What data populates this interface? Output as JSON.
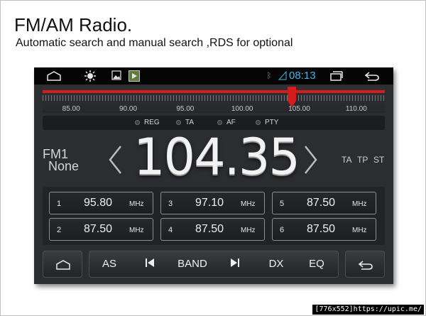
{
  "page": {
    "headline": "FM/AM Radio.",
    "subline": "Automatic search and manual search ,RDS for optional",
    "watermark": "[776x552]https://upic.me/"
  },
  "statusbar": {
    "time": "08:13",
    "icons": [
      "home-outline-icon",
      "brightness-icon",
      "gallery-icon",
      "media-player-icon",
      "bluetooth-icon",
      "signal-icon",
      "recent-apps-icon",
      "back-icon"
    ]
  },
  "scale": {
    "labels": [
      "85.00",
      "90.00",
      "95.00",
      "100.00",
      "105.00",
      "110.00"
    ],
    "needle_frequency": 104.35,
    "range": [
      82.5,
      112.5
    ]
  },
  "flags": [
    "REG",
    "TA",
    "AF",
    "PTY"
  ],
  "tuner": {
    "band": "FM1",
    "ps_name": "None",
    "frequency": "104.35",
    "rds": [
      "TA",
      "TP",
      "ST"
    ]
  },
  "presets": [
    {
      "num": "1",
      "freq": "95.80",
      "unit": "MHz"
    },
    {
      "num": "3",
      "freq": "97.10",
      "unit": "MHz"
    },
    {
      "num": "5",
      "freq": "87.50",
      "unit": "MHz"
    },
    {
      "num": "2",
      "freq": "87.50",
      "unit": "MHz"
    },
    {
      "num": "4",
      "freq": "87.50",
      "unit": "MHz"
    },
    {
      "num": "6",
      "freq": "87.50",
      "unit": "MHz"
    }
  ],
  "controls": {
    "as": "AS",
    "band": "BAND",
    "dx": "DX",
    "eq": "EQ"
  },
  "colors": {
    "accent_time": "#3fb6e8",
    "scale_red": "#d51c1c"
  }
}
